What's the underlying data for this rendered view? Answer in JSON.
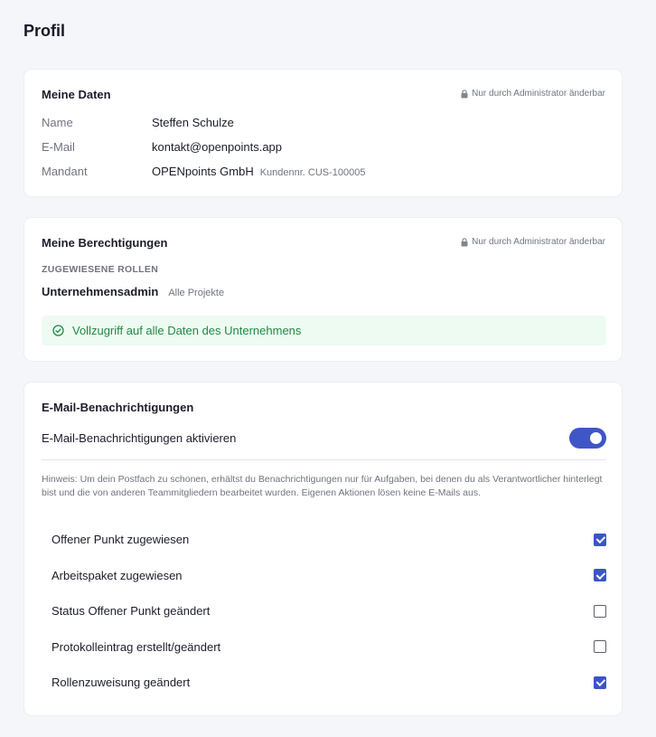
{
  "page": {
    "title": "Profil"
  },
  "my_data": {
    "title": "Meine Daten",
    "admin_note": "Nur durch Administrator änderbar",
    "rows": [
      {
        "label": "Name",
        "value": "Steffen Schulze"
      },
      {
        "label": "E-Mail",
        "value": "kontakt@openpoints.app"
      },
      {
        "label": "Mandant",
        "value": "OPENpoints GmbH",
        "extra": "Kundennr. CUS-100005"
      }
    ]
  },
  "permissions": {
    "title": "Meine Berechtigungen",
    "admin_note": "Nur durch Administrator änderbar",
    "section_label": "ZUGEWIESENE ROLLEN",
    "role_name": "Unternehmensadmin",
    "role_scope": "Alle Projekte",
    "banner_text": "Vollzugriff auf alle Daten des Unternehmens"
  },
  "notifications": {
    "title": "E-Mail-Benachrichtigungen",
    "toggle_label": "E-Mail-Benachrichtigungen aktivieren",
    "toggle_on": true,
    "hint": "Hinweis: Um dein Postfach zu schonen, erhältst du Benachrichtigungen nur für Aufgaben, bei denen du als Verantwortlicher hinterlegt bist und die von anderen Teammitgliedern bearbeitet wurden. Eigenen Aktionen lösen keine E-Mails aus.",
    "items": [
      {
        "label": "Offener Punkt zugewiesen",
        "checked": true
      },
      {
        "label": "Arbeitspaket zugewiesen",
        "checked": true
      },
      {
        "label": "Status Offener Punkt geändert",
        "checked": false
      },
      {
        "label": "Protokolleintrag erstellt/geändert",
        "checked": false
      },
      {
        "label": "Rollenzuweisung geändert",
        "checked": true
      }
    ]
  },
  "colors": {
    "accent": "#3f56c6",
    "success_bg": "#eefbf2",
    "success_text": "#1f8a44",
    "page_bg": "#f5f6fa"
  }
}
